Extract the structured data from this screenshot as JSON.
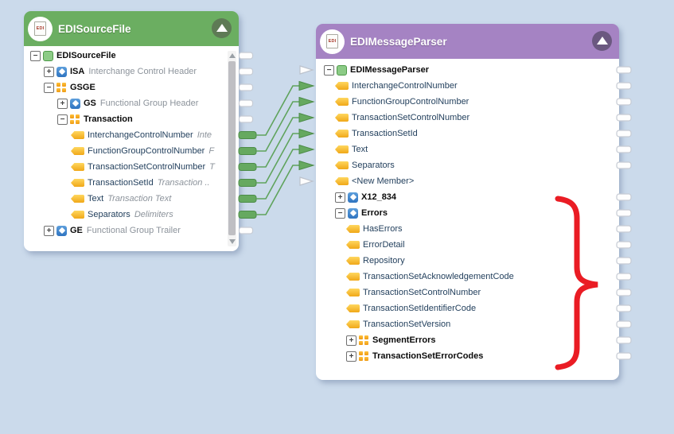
{
  "background_color": "#CBDAEB",
  "colors": {
    "left_header": "#6BAE61",
    "left_collapse_circle": "#5E7A55",
    "right_header": "#A583C3",
    "right_collapse_circle": "#6B5880",
    "connection_green": "#5FA35C",
    "port_green_fill": "#66A960",
    "port_green_stroke": "#4C8C48",
    "port_white_stroke": "#C6CBD4",
    "brace_red": "#EA1C24"
  },
  "left_panel": {
    "title": "EDISourceFile",
    "header_icon": "edi-document-icon",
    "collapse_icon": "triangle-up",
    "rows": [
      {
        "label": "EDISourceFile",
        "icon": "green-square",
        "expander": "minus",
        "indent": 0,
        "bold": true,
        "out_port": "white"
      },
      {
        "label": "ISA",
        "desc": "Interchange Control Header",
        "icon": "blue-star",
        "expander": "plus",
        "indent": 1,
        "bold": true,
        "out_port": "white"
      },
      {
        "label": "GSGE",
        "icon": "orange-grid",
        "expander": "minus",
        "indent": 1,
        "bold": true,
        "out_port": "white"
      },
      {
        "label": "GS",
        "desc": "Functional Group Header",
        "icon": "blue-star",
        "expander": "plus",
        "indent": 2,
        "bold": true,
        "out_port": "white"
      },
      {
        "label": "Transaction",
        "icon": "orange-grid",
        "expander": "minus",
        "indent": 2,
        "bold": true,
        "out_port": "white"
      },
      {
        "label": "InterchangeControlNumber",
        "desc": "Inte",
        "desc_italic": true,
        "icon": "yellow-tag",
        "indent": 3,
        "out_port": "green"
      },
      {
        "label": "FunctionGroupControlNumber",
        "desc": "F",
        "desc_italic": true,
        "icon": "yellow-tag",
        "indent": 3,
        "out_port": "green"
      },
      {
        "label": "TransactionSetControlNumber",
        "desc": "T",
        "desc_italic": true,
        "icon": "yellow-tag",
        "indent": 3,
        "out_port": "green"
      },
      {
        "label": "TransactionSetId",
        "desc": "Transaction ..",
        "desc_italic": true,
        "icon": "yellow-tag",
        "indent": 3,
        "out_port": "green"
      },
      {
        "label": "Text",
        "desc": "Transaction Text",
        "desc_italic": true,
        "icon": "yellow-tag",
        "indent": 3,
        "out_port": "green"
      },
      {
        "label": "Separators",
        "desc": "Delimiters",
        "desc_italic": true,
        "icon": "yellow-tag",
        "indent": 3,
        "out_port": "green"
      },
      {
        "label": "GE",
        "desc": "Functional Group Trailer",
        "icon": "blue-star",
        "expander": "plus",
        "indent": 1,
        "bold": true,
        "out_port": "white"
      }
    ],
    "scrollbar": true
  },
  "right_panel": {
    "title": "EDIMessageParser",
    "header_icon": "edi-document-icon",
    "collapse_icon": "triangle-up",
    "rows": [
      {
        "label": "EDIMessageParser",
        "icon": "green-square",
        "expander": "minus",
        "indent": 0,
        "bold": true,
        "in_port": "hollow",
        "out_port": "white"
      },
      {
        "label": "InterchangeControlNumber",
        "icon": "yellow-tag",
        "indent": 1,
        "in_port": "green",
        "out_port": "white"
      },
      {
        "label": "FunctionGroupControlNumber",
        "icon": "yellow-tag",
        "indent": 1,
        "in_port": "green",
        "out_port": "white"
      },
      {
        "label": "TransactionSetControlNumber",
        "icon": "yellow-tag",
        "indent": 1,
        "in_port": "green",
        "out_port": "white"
      },
      {
        "label": "TransactionSetId",
        "icon": "yellow-tag",
        "indent": 1,
        "in_port": "green",
        "out_port": "white"
      },
      {
        "label": "Text",
        "icon": "yellow-tag",
        "indent": 1,
        "in_port": "green",
        "out_port": "white"
      },
      {
        "label": "Separators",
        "icon": "yellow-tag",
        "indent": 1,
        "in_port": "green",
        "out_port": "white"
      },
      {
        "label": "<New Member>",
        "icon": "yellow-tag",
        "indent": 1,
        "in_port": "hollow"
      },
      {
        "label": "X12_834",
        "icon": "blue-star",
        "expander": "plus",
        "indent": 1,
        "bold": true,
        "out_port": "white"
      },
      {
        "label": "Errors",
        "icon": "blue-star",
        "expander": "minus",
        "indent": 1,
        "bold": true,
        "out_port": "white"
      },
      {
        "label": "HasErrors",
        "icon": "yellow-tag",
        "indent": 2,
        "out_port": "white"
      },
      {
        "label": "ErrorDetail",
        "icon": "yellow-tag",
        "indent": 2,
        "out_port": "white"
      },
      {
        "label": "Repository",
        "icon": "yellow-tag",
        "indent": 2,
        "out_port": "white"
      },
      {
        "label": "TransactionSetAcknowledgementCode",
        "icon": "yellow-tag",
        "indent": 2,
        "out_port": "white"
      },
      {
        "label": "TransactionSetControlNumber",
        "icon": "yellow-tag",
        "indent": 2,
        "out_port": "white"
      },
      {
        "label": "TransactionSetIdentifierCode",
        "icon": "yellow-tag",
        "indent": 2,
        "out_port": "white"
      },
      {
        "label": "TransactionSetVersion",
        "icon": "yellow-tag",
        "indent": 2,
        "out_port": "white"
      },
      {
        "label": "SegmentErrors",
        "icon": "orange-grid",
        "expander": "plus",
        "indent": 2,
        "bold": true,
        "out_port": "white"
      },
      {
        "label": "TransactionSetErrorCodes",
        "icon": "orange-grid",
        "expander": "plus",
        "indent": 2,
        "bold": true,
        "out_port": "white"
      }
    ]
  },
  "connections": [
    {
      "label": "InterchangeControlNumber",
      "from_row": 5,
      "to_row": 1
    },
    {
      "label": "FunctionGroupControlNumber",
      "from_row": 6,
      "to_row": 2
    },
    {
      "label": "TransactionSetControlNumber",
      "from_row": 7,
      "to_row": 3
    },
    {
      "label": "TransactionSetId",
      "from_row": 8,
      "to_row": 4
    },
    {
      "label": "Text",
      "from_row": 9,
      "to_row": 5
    },
    {
      "label": "Separators",
      "from_row": 10,
      "to_row": 6
    }
  ],
  "annotation": {
    "type": "closing-brace",
    "color": "#EA1C24",
    "spans_rows": "Errors…TransactionSetErrorCodes"
  }
}
